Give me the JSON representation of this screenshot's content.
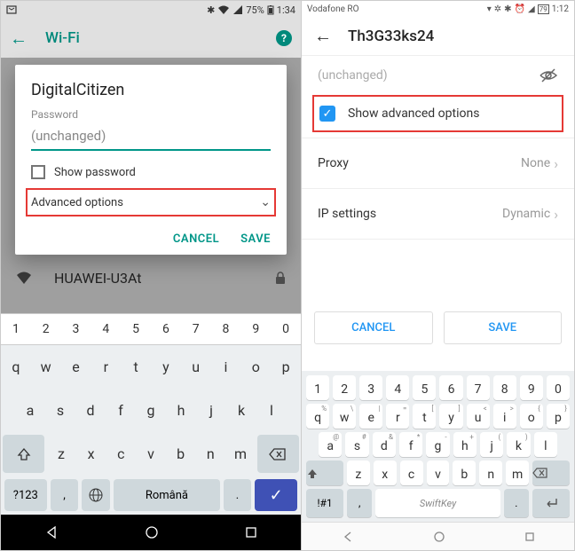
{
  "left": {
    "status": {
      "battery_pct": "75%",
      "time": "1:34"
    },
    "appbar": {
      "title": "Wi-Fi"
    },
    "behind_network": "HUAWEI-U3At",
    "dialog": {
      "ssid": "DigitalCitizen",
      "pw_label": "Password",
      "pw_value": "(unchanged)",
      "show_pw": "Show password",
      "advanced": "Advanced options",
      "cancel": "CANCEL",
      "save": "SAVE"
    },
    "keyboard": {
      "numbers": [
        "1",
        "2",
        "3",
        "4",
        "5",
        "6",
        "7",
        "8",
        "9",
        "0"
      ],
      "row1": [
        "q",
        "w",
        "e",
        "r",
        "t",
        "y",
        "u",
        "i",
        "o",
        "p"
      ],
      "row2": [
        "a",
        "s",
        "d",
        "f",
        "g",
        "h",
        "j",
        "k",
        "l"
      ],
      "row3": [
        "z",
        "x",
        "c",
        "v",
        "b",
        "n",
        "m"
      ],
      "sym": "?123",
      "comma": ",",
      "space": "Română",
      "period": "."
    }
  },
  "right": {
    "status": {
      "carrier": "Vodafone RO",
      "battery": "79",
      "time": "1:12"
    },
    "appbar": {
      "title": "Th3G33ks24"
    },
    "pw_placeholder": "(unchanged)",
    "adv_label": "Show advanced options",
    "proxy": {
      "label": "Proxy",
      "value": "None"
    },
    "ip": {
      "label": "IP settings",
      "value": "Dynamic"
    },
    "cancel": "CANCEL",
    "save": "SAVE",
    "keyboard": {
      "numbers": [
        "1",
        "2",
        "3",
        "4",
        "5",
        "6",
        "7",
        "8",
        "9",
        "0"
      ],
      "row1": [
        "q",
        "w",
        "e",
        "r",
        "t",
        "y",
        "u",
        "i",
        "o",
        "p"
      ],
      "row2": [
        "a",
        "s",
        "d",
        "f",
        "g",
        "h",
        "j",
        "k",
        "l"
      ],
      "row3": [
        "z",
        "x",
        "c",
        "v",
        "b",
        "n",
        "m"
      ],
      "sym1": "!#1",
      "comma": ",",
      "space": "SwiftKey",
      "period": "."
    }
  }
}
